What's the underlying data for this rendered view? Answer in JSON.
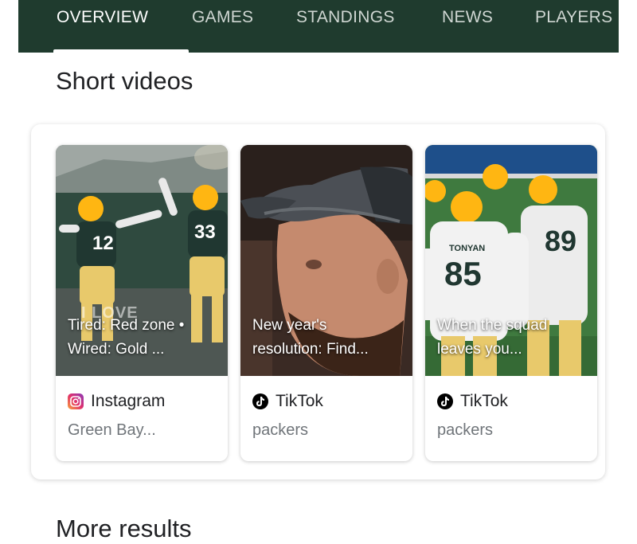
{
  "nav": {
    "tabs": [
      {
        "label": "OVERVIEW",
        "active": true
      },
      {
        "label": "GAMES"
      },
      {
        "label": "STANDINGS"
      },
      {
        "label": "NEWS"
      },
      {
        "label": "PLAYERS"
      }
    ]
  },
  "short_videos": {
    "title": "Short videos",
    "cards": [
      {
        "caption": "Tired: Red zone •\nWired: Gold ...",
        "source": "Instagram",
        "source_icon": "instagram-icon",
        "subtitle": "Green Bay...",
        "thumb_text": "I LOVE",
        "jerseys": [
          "12",
          "33"
        ]
      },
      {
        "caption": "New year's\nresolution: Find...",
        "source": "TikTok",
        "source_icon": "tiktok-icon",
        "subtitle": "packers"
      },
      {
        "caption": "When the squad\nleaves you...",
        "source": "TikTok",
        "source_icon": "tiktok-icon",
        "subtitle": "packers",
        "jerseys": [
          "TONYAN",
          "85",
          "89"
        ]
      }
    ]
  },
  "more_results": {
    "title": "More results"
  },
  "colors": {
    "topbar": "#1f3b2e",
    "jersey_green": "#203731",
    "helmet_gold": "#ffb612"
  }
}
